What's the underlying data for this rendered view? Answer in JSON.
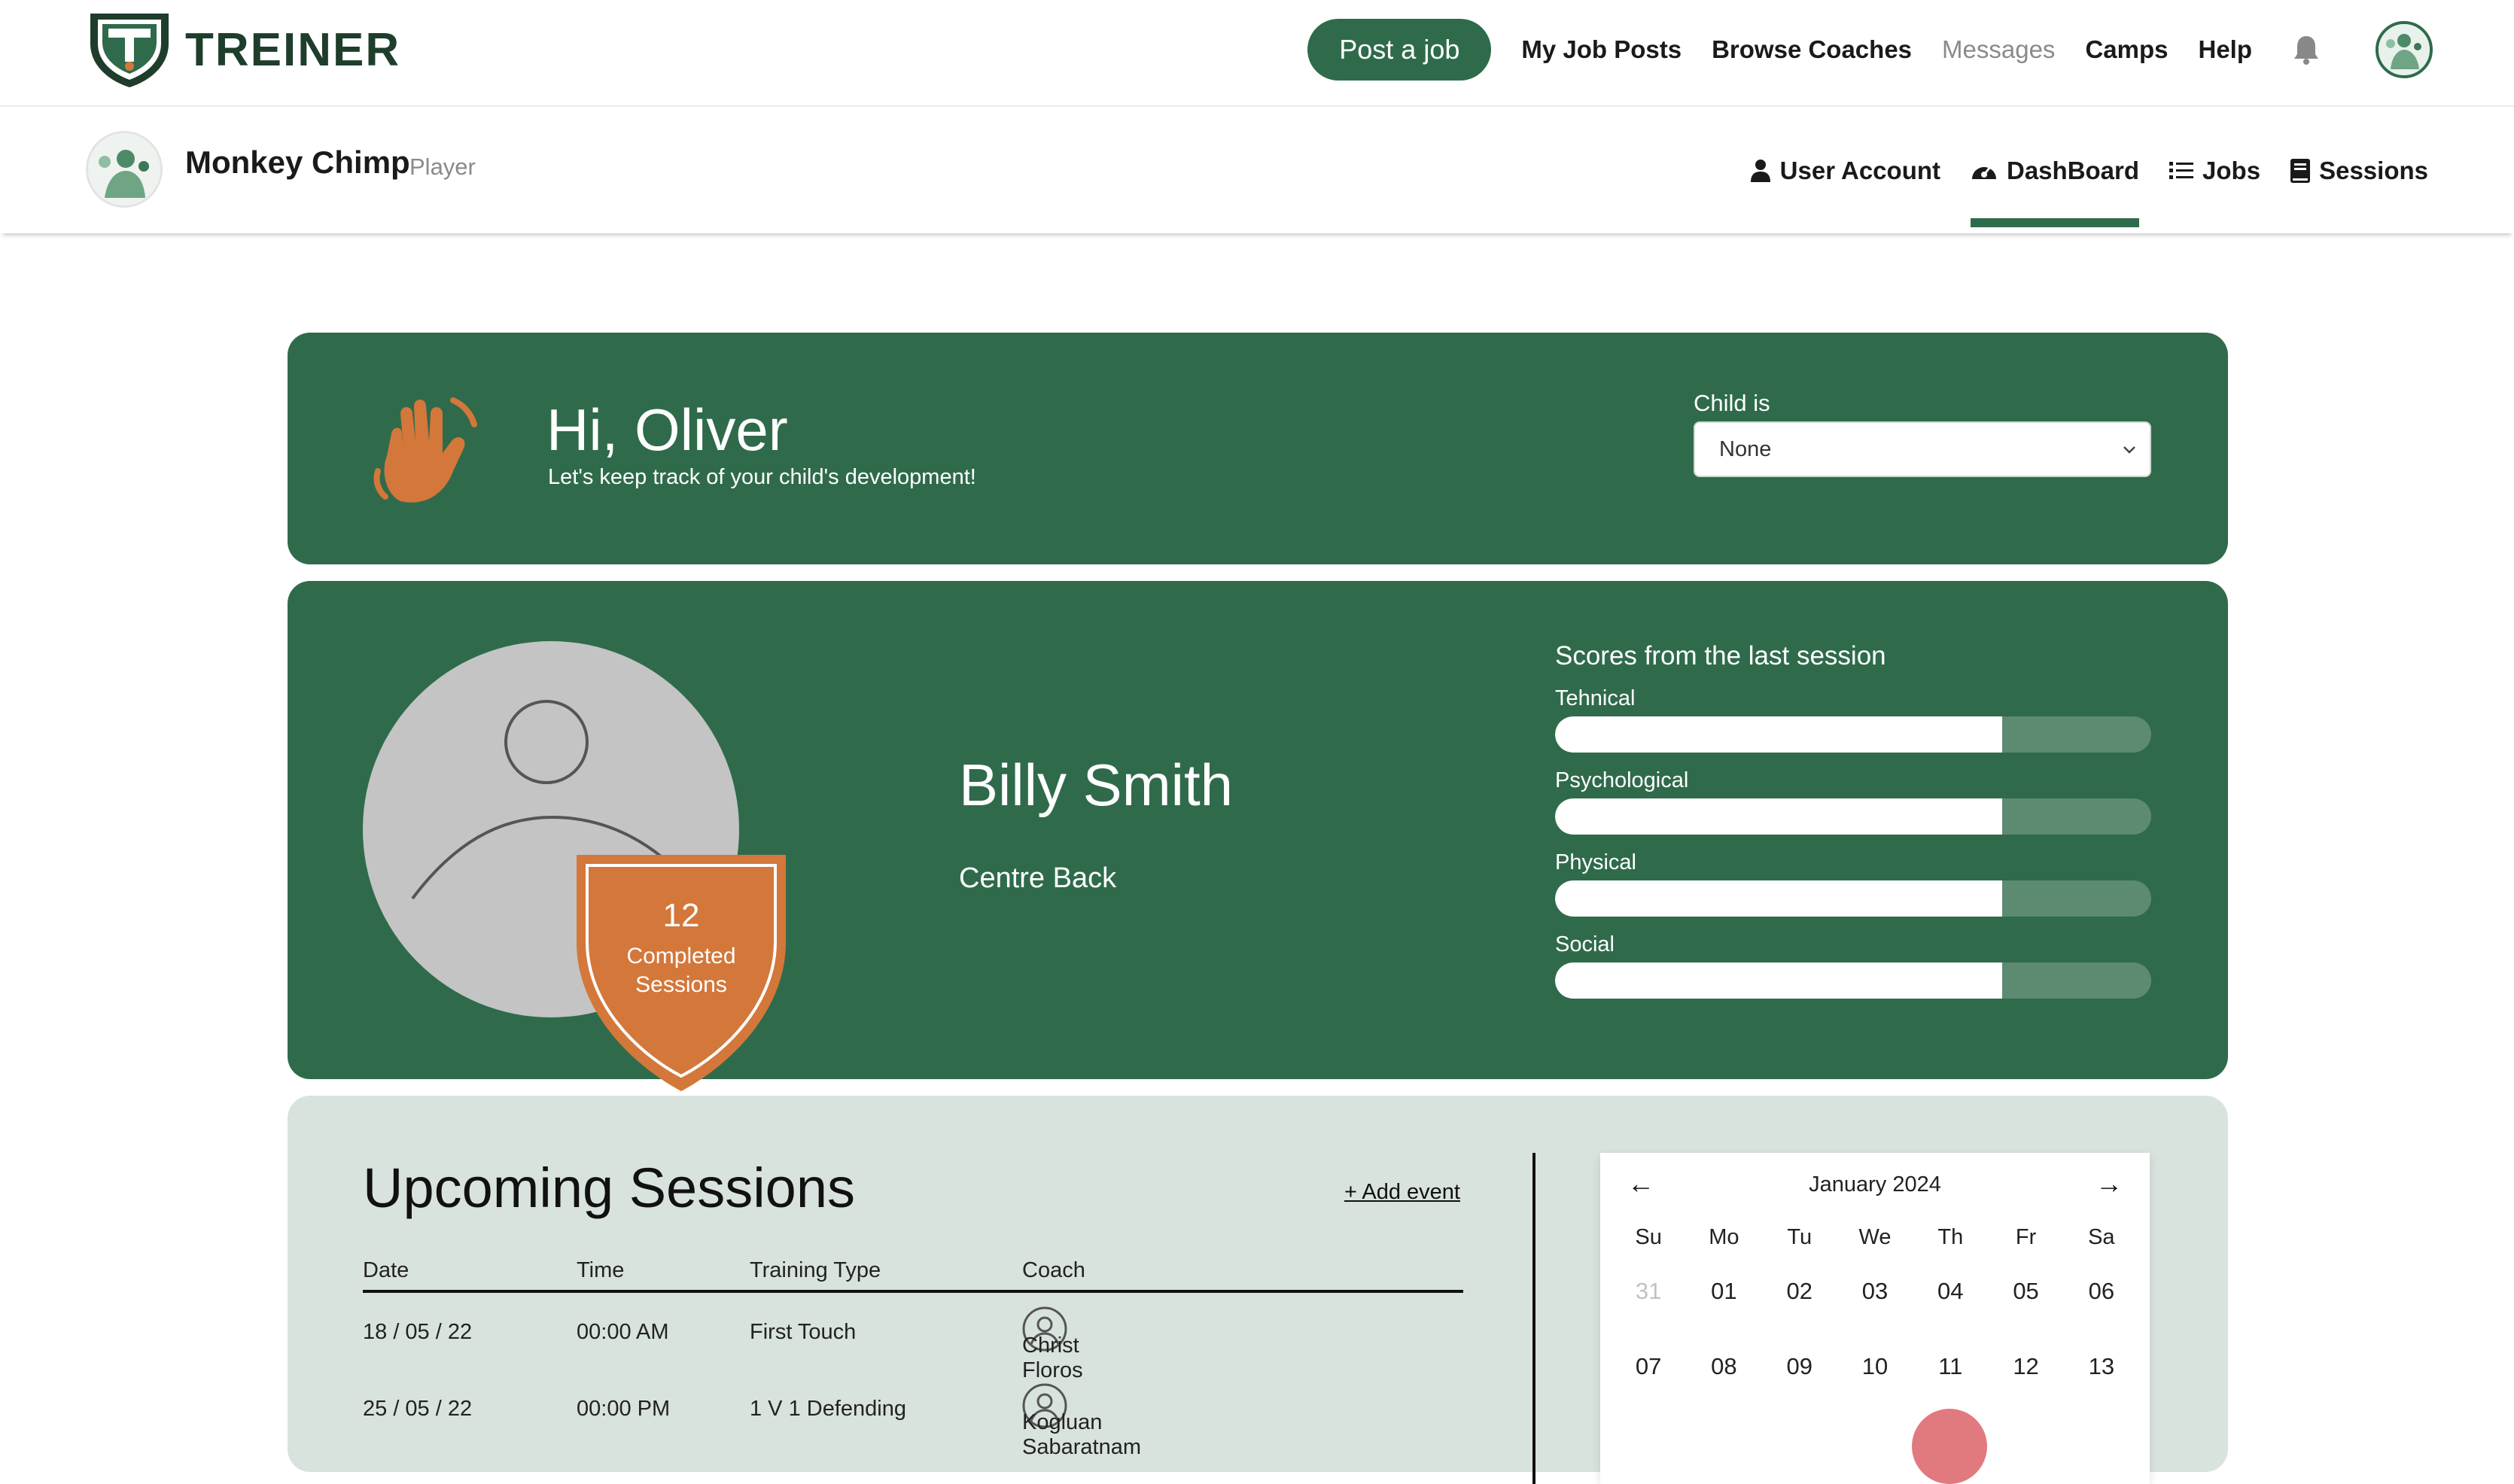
{
  "app": {
    "logo_text": "TREINER"
  },
  "topnav": {
    "post_job": "Post a job",
    "my_job_posts": "My Job Posts",
    "browse_coaches": "Browse Coaches",
    "messages": "Messages",
    "camps": "Camps",
    "help": "Help"
  },
  "profile": {
    "name": "Monkey Chimp",
    "role": "Player"
  },
  "subnav": {
    "user_account": "User Account",
    "dashboard": "DashBoard",
    "jobs": "Jobs",
    "sessions": "Sessions",
    "active": "dashboard"
  },
  "greeting": {
    "title": "Hi, Oliver",
    "subtitle": "Let's keep track of your child's development!",
    "child_label": "Child is",
    "child_value": "None"
  },
  "player": {
    "name": "Billy Smith",
    "position": "Centre Back",
    "badge_count": "12",
    "badge_line1": "Completed",
    "badge_line2": "Sessions"
  },
  "scores": {
    "title": "Scores from the last session",
    "items": [
      {
        "label": "Tehnical",
        "value": 0.75
      },
      {
        "label": "Psychological",
        "value": 0.75
      },
      {
        "label": "Physical",
        "value": 0.75
      },
      {
        "label": "Social",
        "value": 0.75
      }
    ]
  },
  "sessions": {
    "title": "Upcoming Sessions",
    "add_event": "+ Add event",
    "columns": [
      "Date",
      "Time",
      "Training Type",
      "Coach"
    ],
    "rows": [
      {
        "date": "18 / 05 / 22",
        "time": "00:00 AM",
        "type": "First Touch",
        "coach": "Christ Floros"
      },
      {
        "date": "25 / 05 / 22",
        "time": "00:00 PM",
        "type": "1 V 1 Defending",
        "coach": "Kogluan Sabaratnam"
      }
    ]
  },
  "calendar": {
    "month": "January 2024",
    "prev": "←",
    "next": "→",
    "dow": [
      "Su",
      "Mo",
      "Tu",
      "We",
      "Th",
      "Fr",
      "Sa"
    ],
    "days": [
      "31",
      "01",
      "02",
      "03",
      "04",
      "05",
      "06",
      "07",
      "08",
      "09",
      "10",
      "11",
      "12",
      "13"
    ],
    "highlight_color": "#e07a7f"
  },
  "colors": {
    "brand_green": "#2f6b4b",
    "badge_orange": "#d4773a",
    "panel_bg": "#d9e3dd"
  }
}
